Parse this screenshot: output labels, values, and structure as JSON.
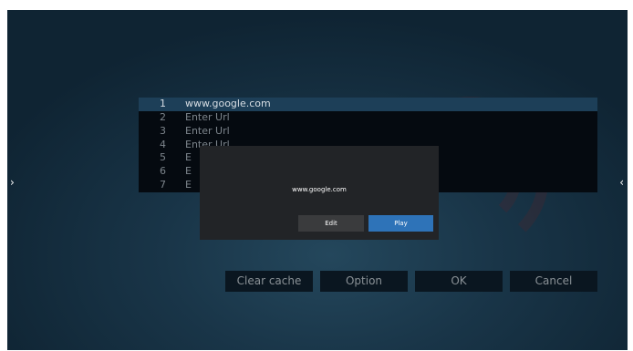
{
  "nav": {
    "left_arrow": "›",
    "right_arrow": "‹"
  },
  "url_list": {
    "rows": [
      {
        "num": "1",
        "url": "www.google.com",
        "selected": true
      },
      {
        "num": "2",
        "url": "Enter Url"
      },
      {
        "num": "3",
        "url": "Enter Url"
      },
      {
        "num": "4",
        "url": "Enter Url"
      },
      {
        "num": "5",
        "url": "E"
      },
      {
        "num": "6",
        "url": "E"
      },
      {
        "num": "7",
        "url": "E"
      }
    ]
  },
  "dialog": {
    "url": "www.google.com",
    "edit_label": "Edit",
    "play_label": "Play"
  },
  "buttons": {
    "clear_cache": "Clear cache",
    "option": "Option",
    "ok": "OK",
    "cancel": "Cancel"
  },
  "colors": {
    "background": "#193548",
    "selected_row": "#1d3f58",
    "play_button": "#2e73b8",
    "dialog": "#222427"
  }
}
